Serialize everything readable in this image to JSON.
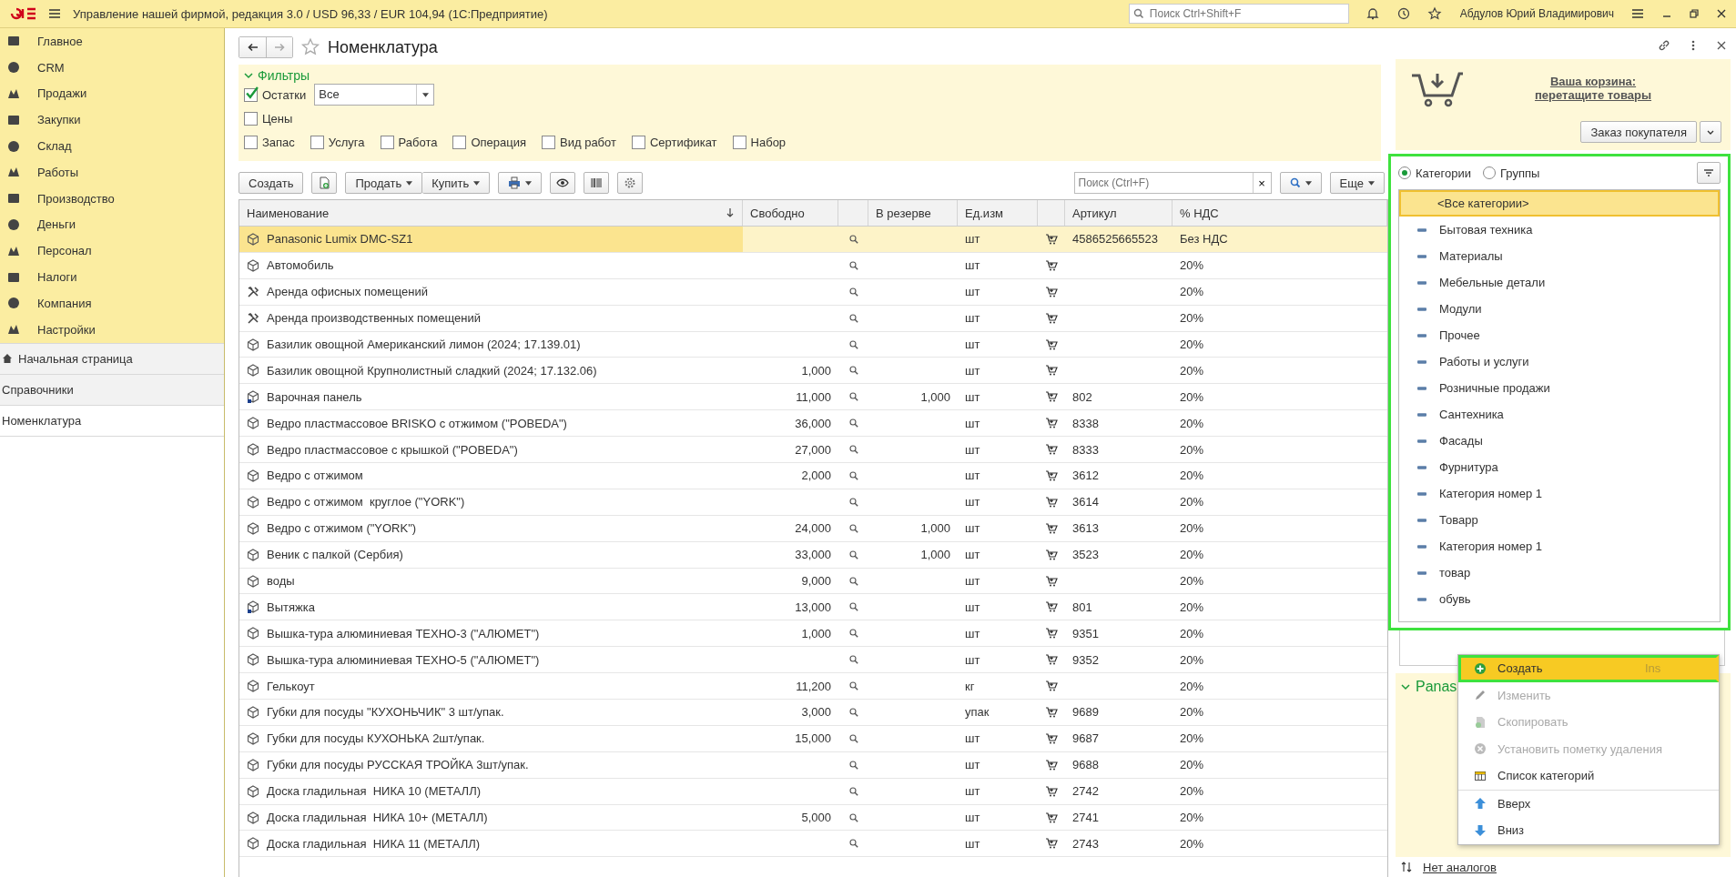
{
  "window": {
    "title": "Управление нашей фирмой, редакция 3.0 / USD 96,33 / EUR 104,94  (1С:Предприятие)",
    "search_placeholder": "Поиск Ctrl+Shift+F",
    "user": "Абдулов Юрий Владимирович"
  },
  "sidebar": {
    "sections": [
      {
        "label": "Главное"
      },
      {
        "label": "CRM"
      },
      {
        "label": "Продажи"
      },
      {
        "label": "Закупки"
      },
      {
        "label": "Склад"
      },
      {
        "label": "Работы"
      },
      {
        "label": "Производство"
      },
      {
        "label": "Деньги"
      },
      {
        "label": "Персонал"
      },
      {
        "label": "Налоги"
      },
      {
        "label": "Компания"
      },
      {
        "label": "Настройки"
      }
    ],
    "open_pages": [
      {
        "label": "Начальная страница",
        "selected": false
      },
      {
        "label": "Справочники",
        "selected": false
      },
      {
        "label": "Номенклатура",
        "selected": true
      }
    ]
  },
  "page": {
    "title": "Номенклатура"
  },
  "filters": {
    "title": "Фильтры",
    "expanded": true,
    "stock": {
      "label": "Остатки",
      "checked": true,
      "value": "Все"
    },
    "prices": {
      "label": "Цены",
      "checked": false
    },
    "types": [
      {
        "label": "Запас",
        "checked": false
      },
      {
        "label": "Услуга",
        "checked": false
      },
      {
        "label": "Работа",
        "checked": false
      },
      {
        "label": "Операция",
        "checked": false
      },
      {
        "label": "Вид работ",
        "checked": false
      },
      {
        "label": "Сертификат",
        "checked": false
      },
      {
        "label": "Набор",
        "checked": false
      }
    ]
  },
  "toolbar": {
    "create": "Создать",
    "sell": "Продать",
    "buy": "Купить",
    "search_placeholder": "Поиск (Ctrl+F)",
    "clear": "×",
    "more": "Еще"
  },
  "table": {
    "columns": [
      "Наименование",
      "Свободно",
      "В резерве",
      "Ед.изм",
      "Артикул",
      "% НДС"
    ],
    "rows": [
      {
        "kind": "goods",
        "name": "Panasonic Lumix DMC-SZ1",
        "free": "",
        "reserve": "",
        "unit": "шт",
        "article": "4586525665523",
        "vat": "Без НДС",
        "selected": true
      },
      {
        "kind": "goods",
        "name": "Автомобиль",
        "free": "",
        "reserve": "",
        "unit": "шт",
        "article": "",
        "vat": "20%",
        "selected": false
      },
      {
        "kind": "service",
        "name": "Аренда офисных помещений",
        "free": "",
        "reserve": "",
        "unit": "шт",
        "article": "",
        "vat": "20%",
        "selected": false
      },
      {
        "kind": "service",
        "name": "Аренда производственных помещений",
        "free": "",
        "reserve": "",
        "unit": "шт",
        "article": "",
        "vat": "20%",
        "selected": false
      },
      {
        "kind": "goods",
        "name": "Базилик овощной Американский лимон (2024; 17.139.01)",
        "free": "",
        "reserve": "",
        "unit": "шт",
        "article": "",
        "vat": "20%",
        "selected": false
      },
      {
        "kind": "goods",
        "name": "Базилик овощной Крупнолистный сладкий (2024; 17.132.06)",
        "free": "1,000",
        "reserve": "",
        "unit": "шт",
        "article": "",
        "vat": "20%",
        "selected": false
      },
      {
        "kind": "marked",
        "name": "Варочная панель",
        "free": "11,000",
        "reserve": "1,000",
        "unit": "шт",
        "article": "802",
        "vat": "20%",
        "selected": false
      },
      {
        "kind": "goods",
        "name": "Ведро пластмассовое BRISKO с отжимом (\"POBEDA\")",
        "free": "36,000",
        "reserve": "",
        "unit": "шт",
        "article": "8338",
        "vat": "20%",
        "selected": false
      },
      {
        "kind": "goods",
        "name": "Ведро пластмассовое с крышкой (\"POBEDA\")",
        "free": "27,000",
        "reserve": "",
        "unit": "шт",
        "article": "8333",
        "vat": "20%",
        "selected": false
      },
      {
        "kind": "goods",
        "name": "Ведро с отжимом",
        "free": "2,000",
        "reserve": "",
        "unit": "шт",
        "article": "3612",
        "vat": "20%",
        "selected": false
      },
      {
        "kind": "goods",
        "name": "Ведро с отжимом  круглое (\"YORK\")",
        "free": "",
        "reserve": "",
        "unit": "шт",
        "article": "3614",
        "vat": "20%",
        "selected": false
      },
      {
        "kind": "goods",
        "name": "Ведро с отжимом (\"YORK\")",
        "free": "24,000",
        "reserve": "1,000",
        "unit": "шт",
        "article": "3613",
        "vat": "20%",
        "selected": false
      },
      {
        "kind": "goods",
        "name": "Веник с палкой (Сербия)",
        "free": "33,000",
        "reserve": "1,000",
        "unit": "шт",
        "article": "3523",
        "vat": "20%",
        "selected": false
      },
      {
        "kind": "goods",
        "name": "воды",
        "free": "9,000",
        "reserve": "",
        "unit": "шт",
        "article": "",
        "vat": "20%",
        "selected": false
      },
      {
        "kind": "marked",
        "name": "Вытяжка",
        "free": "13,000",
        "reserve": "",
        "unit": "шт",
        "article": "801",
        "vat": "20%",
        "selected": false
      },
      {
        "kind": "goods",
        "name": "Вышка-тура алюминиевая ТЕХНО-3 (\"АЛЮМЕТ\")",
        "free": "1,000",
        "reserve": "",
        "unit": "шт",
        "article": "9351",
        "vat": "20%",
        "selected": false
      },
      {
        "kind": "goods",
        "name": "Вышка-тура алюминиевая ТЕХНО-5 (\"АЛЮМЕТ\")",
        "free": "",
        "reserve": "",
        "unit": "шт",
        "article": "9352",
        "vat": "20%",
        "selected": false
      },
      {
        "kind": "goods",
        "name": "Гелькоут",
        "free": "11,200",
        "reserve": "",
        "unit": "кг",
        "article": "",
        "vat": "20%",
        "selected": false
      },
      {
        "kind": "goods",
        "name": "Губки для посуды \"КУХОНЬЧИК\" 3 шт/упак.",
        "free": "3,000",
        "reserve": "",
        "unit": "упак",
        "article": "9689",
        "vat": "20%",
        "selected": false
      },
      {
        "kind": "goods",
        "name": "Губки для посуды КУХОНЬКА 2шт/упак.",
        "free": "15,000",
        "reserve": "",
        "unit": "шт",
        "article": "9687",
        "vat": "20%",
        "selected": false
      },
      {
        "kind": "goods",
        "name": "Губки для посуды РУССКАЯ ТРОЙКА 3шт/упак.",
        "free": "",
        "reserve": "",
        "unit": "шт",
        "article": "9688",
        "vat": "20%",
        "selected": false
      },
      {
        "kind": "goods",
        "name": "Доска гладильная  НИКА 10 (МЕТАЛЛ)",
        "free": "",
        "reserve": "",
        "unit": "шт",
        "article": "2742",
        "vat": "20%",
        "selected": false
      },
      {
        "kind": "goods",
        "name": "Доска гладильная  НИКА 10+ (МЕТАЛЛ)",
        "free": "5,000",
        "reserve": "",
        "unit": "шт",
        "article": "2741",
        "vat": "20%",
        "selected": false
      },
      {
        "kind": "goods",
        "name": "Доска гладильная  НИКА 11 (МЕТАЛЛ)",
        "free": "",
        "reserve": "",
        "unit": "шт",
        "article": "2743",
        "vat": "20%",
        "selected": false
      }
    ]
  },
  "cart": {
    "link": "Ваша корзина:\nперетащите товары",
    "button": "Заказ покупателя"
  },
  "categories": {
    "highlighted": true,
    "modes": [
      {
        "label": "Категории",
        "selected": true
      },
      {
        "label": "Группы",
        "selected": false
      }
    ],
    "items": [
      {
        "label": "<Все категории>",
        "selected": true
      },
      {
        "label": "Бытовая техника",
        "selected": false
      },
      {
        "label": "Материалы",
        "selected": false
      },
      {
        "label": "Мебельные детали",
        "selected": false
      },
      {
        "label": "Модули",
        "selected": false
      },
      {
        "label": "Прочее",
        "selected": false
      },
      {
        "label": "Работы и услуги",
        "selected": false
      },
      {
        "label": "Розничные продажи",
        "selected": false
      },
      {
        "label": "Сантехника",
        "selected": false
      },
      {
        "label": "Фасады",
        "selected": false
      },
      {
        "label": "Фурнитура",
        "selected": false
      },
      {
        "label": "Категория номер 1",
        "selected": false
      },
      {
        "label": "Товарр",
        "selected": false
      },
      {
        "label": "Категория номер 1",
        "selected": false
      },
      {
        "label": "товар",
        "selected": false
      },
      {
        "label": "обувь",
        "selected": false
      }
    ]
  },
  "details": {
    "title": "Panas",
    "analogs": "Нет аналогов"
  },
  "context_menu": {
    "groups": [
      [
        {
          "label": "Создать",
          "shortcut": "Ins",
          "selected": true,
          "disabled": false,
          "highlighted": true
        },
        {
          "label": "Изменить",
          "selected": false,
          "disabled": true,
          "highlighted": false
        },
        {
          "label": "Скопировать",
          "selected": false,
          "disabled": true,
          "highlighted": false
        },
        {
          "label": "Установить пометку удаления",
          "selected": false,
          "disabled": true,
          "highlighted": false
        },
        {
          "label": "Список категорий",
          "selected": false,
          "disabled": false,
          "highlighted": false
        }
      ],
      [
        {
          "label": "Вверх",
          "selected": false,
          "disabled": false,
          "highlighted": false
        },
        {
          "label": "Вниз",
          "selected": false,
          "disabled": false,
          "highlighted": false
        }
      ]
    ]
  }
}
